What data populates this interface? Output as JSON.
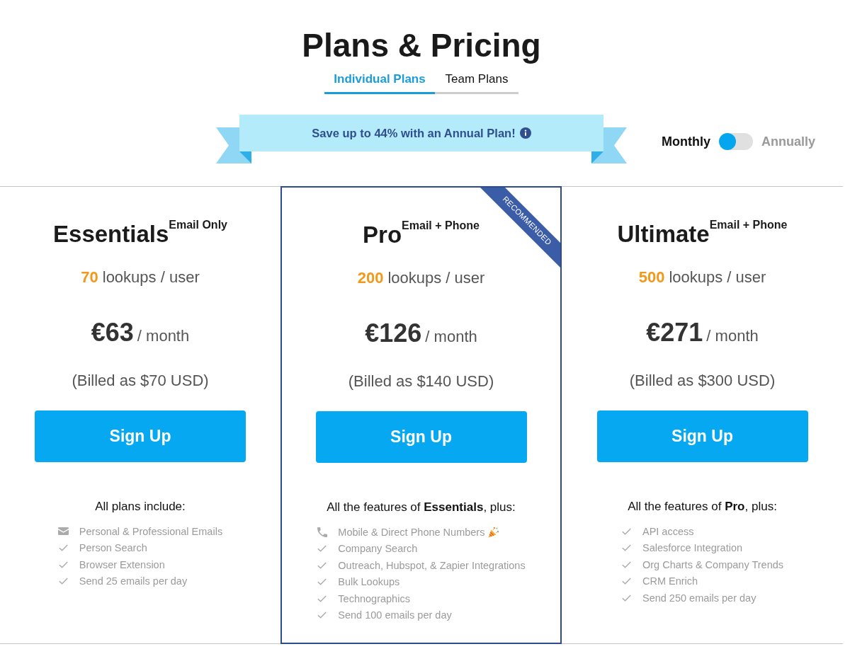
{
  "page": {
    "title": "Plans & Pricing"
  },
  "tabs": [
    {
      "label": "Individual Plans",
      "selected": true
    },
    {
      "label": "Team Plans",
      "selected": false
    }
  ],
  "banner": {
    "text": "Save up to 44% with an Annual Plan!"
  },
  "billing": {
    "left_label": "Monthly",
    "right_label": "Annually",
    "on": false
  },
  "plans": [
    {
      "name": "Essentials",
      "tier": "Email Only",
      "highlighted": false,
      "lookups": "70",
      "lookups_unit": "lookups / user",
      "price": "€63",
      "period": "/ month",
      "billed": "(Billed as $70 USD)",
      "button": "Sign Up",
      "features_heading": "All plans include:",
      "features": [
        {
          "kind": "envelope",
          "text": "Personal & Professional Emails"
        },
        {
          "kind": "check",
          "text": "Person Search"
        },
        {
          "kind": "check",
          "text": "Browser Extension"
        },
        {
          "kind": "check",
          "text": "Send 25 emails per day"
        }
      ]
    },
    {
      "name": "Pro",
      "tier": "Email + Phone",
      "highlighted": true,
      "ribbon": "RECOMMENDED",
      "lookups": "200",
      "lookups_unit": "lookups / user",
      "price": "€126",
      "period": "/ month",
      "billed": "(Billed as $140 USD)",
      "button": "Sign Up",
      "features_heading": "All the features of **Essentials**, plus:",
      "features": [
        {
          "kind": "phone",
          "text": "Mobile & Direct Phone Numbers",
          "celebration": true
        },
        {
          "kind": "check",
          "text": "Company Search"
        },
        {
          "kind": "check",
          "text": "Outreach, Hubspot, & Zapier Integrations"
        },
        {
          "kind": "check",
          "text": "Bulk Lookups"
        },
        {
          "kind": "check",
          "text": "Technographics"
        },
        {
          "kind": "check",
          "text": "Send 100 emails per day"
        }
      ]
    },
    {
      "name": "Ultimate",
      "tier": "Email + Phone",
      "highlighted": false,
      "lookups": "500",
      "lookups_unit": "lookups / user",
      "price": "€271",
      "period": "/ month",
      "billed": "(Billed as $300 USD)",
      "button": "Sign Up",
      "features_heading": "All the features of **Pro**, plus:",
      "features": [
        {
          "kind": "check",
          "text": "API access"
        },
        {
          "kind": "check",
          "text": "Salesforce Integration"
        },
        {
          "kind": "check",
          "text": "Org Charts & Company Trends"
        },
        {
          "kind": "check",
          "text": "CRM Enrich"
        },
        {
          "kind": "check",
          "text": "Send 250 emails per day"
        }
      ]
    }
  ]
}
